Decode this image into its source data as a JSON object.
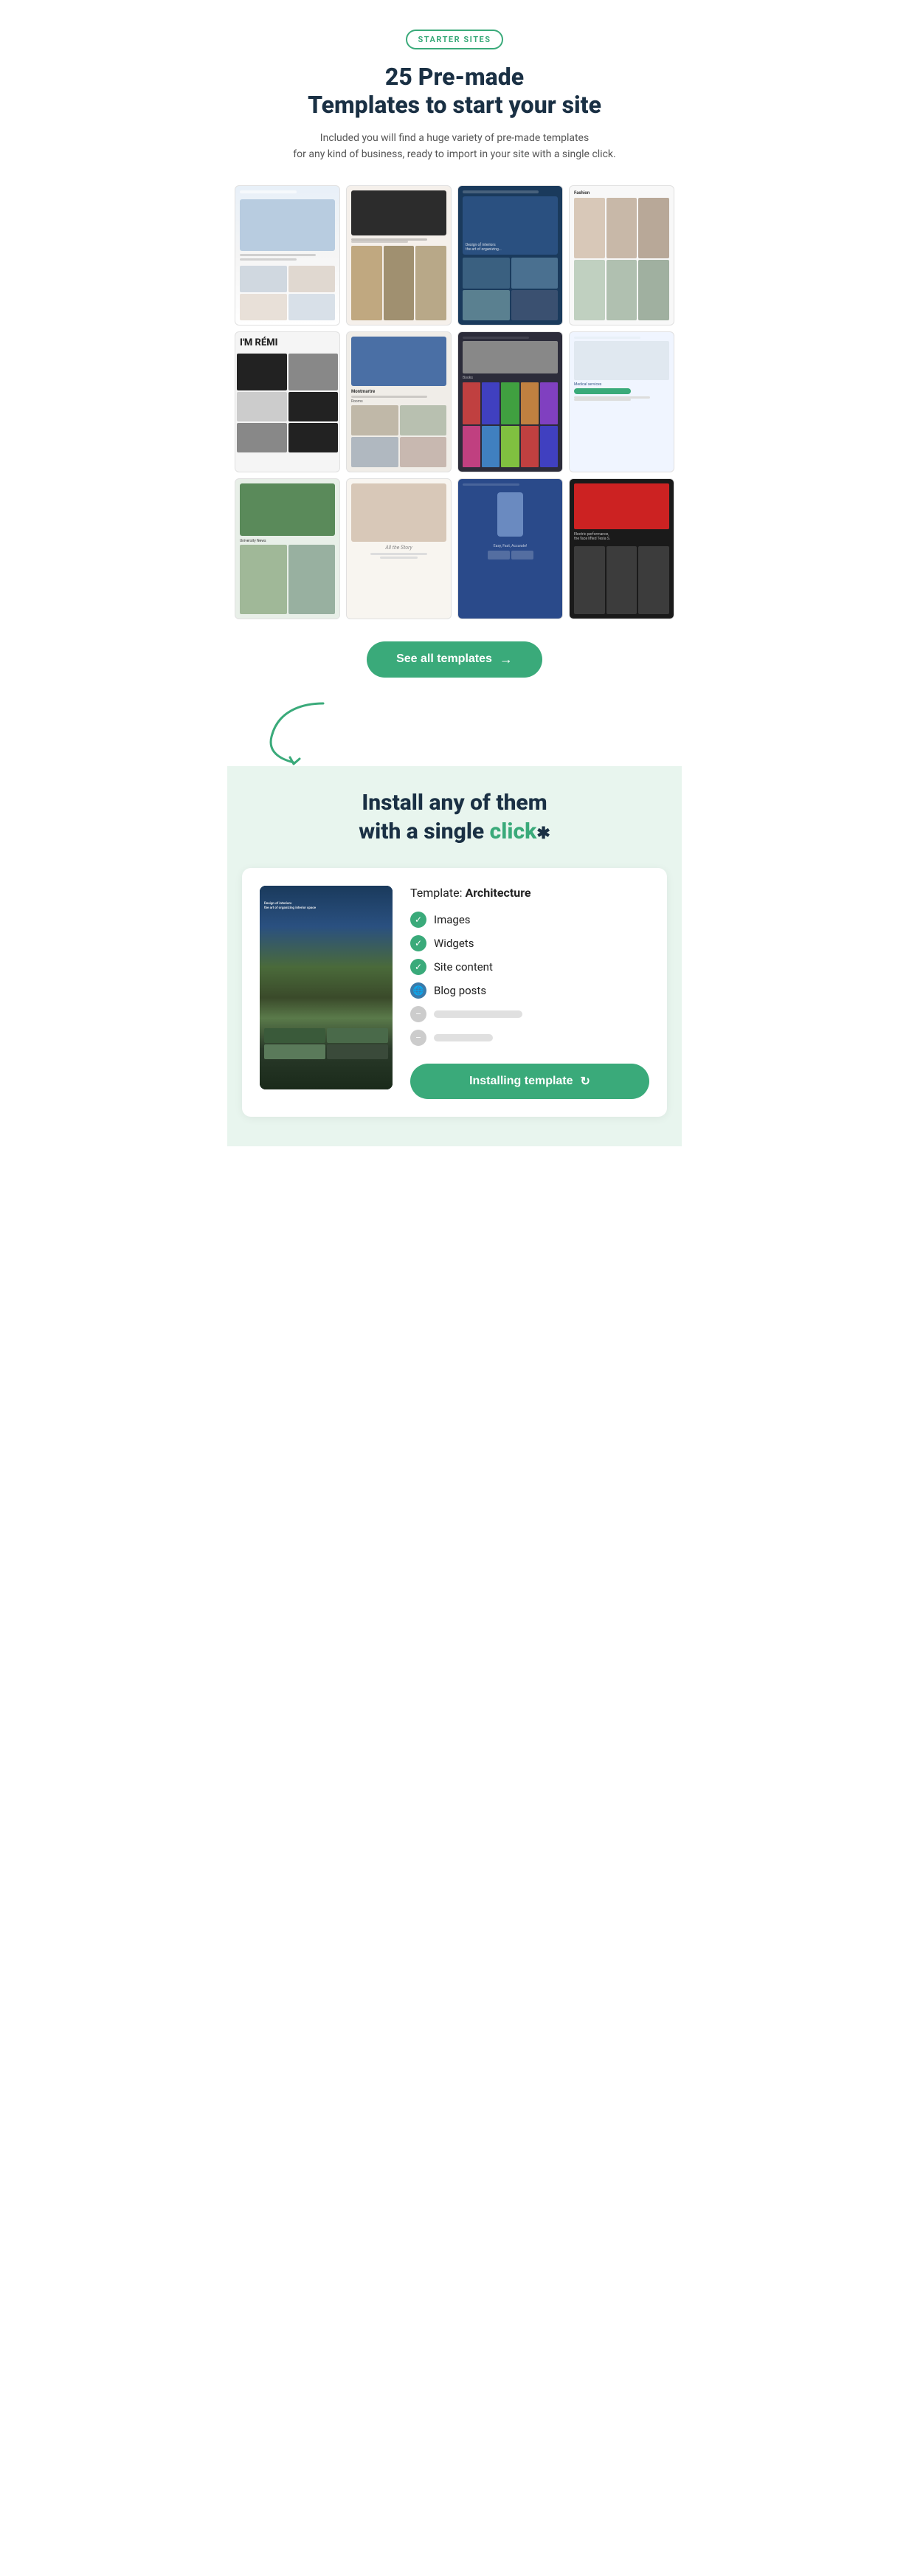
{
  "badge": {
    "label": "STARTER SITES"
  },
  "section": {
    "title_line1": "25 Pre-made",
    "title_line2": "Templates to start your site",
    "description": "Included you will find a huge variety of pre-made templates\nfor any kind of business, ready to import in your site with a single click."
  },
  "templates": [
    {
      "id": 1,
      "name": "portfolio-1",
      "style": "tmpl-1"
    },
    {
      "id": 2,
      "name": "law-firm",
      "style": "tmpl-2"
    },
    {
      "id": 3,
      "name": "architecture",
      "style": "tmpl-3"
    },
    {
      "id": 4,
      "name": "fashion-store",
      "style": "tmpl-4"
    },
    {
      "id": 5,
      "name": "remi-personal",
      "style": "card-remi"
    },
    {
      "id": 6,
      "name": "hotel",
      "style": "tmpl-6"
    },
    {
      "id": 7,
      "name": "bookstore",
      "style": "tmpl-7"
    },
    {
      "id": 8,
      "name": "medical",
      "style": "tmpl-8"
    },
    {
      "id": 9,
      "name": "university",
      "style": "tmpl-9"
    },
    {
      "id": 10,
      "name": "wedding",
      "style": "tmpl-10"
    },
    {
      "id": 11,
      "name": "weather-app",
      "style": "tmpl-12"
    },
    {
      "id": 12,
      "name": "electric-car",
      "style": "tmpl-13"
    }
  ],
  "see_all_btn": {
    "label": "See all templates",
    "arrow": "→"
  },
  "install_section": {
    "title_line1": "Install any of them",
    "title_line2_prefix": "with a single ",
    "title_line2_highlight": "click",
    "title_line2_suffix": ""
  },
  "install_card": {
    "template_label": "Template:",
    "template_name": "Architecture",
    "features": [
      {
        "label": "Images",
        "status": "checked",
        "type": "green"
      },
      {
        "label": "Widgets",
        "status": "checked",
        "type": "green"
      },
      {
        "label": "Site content",
        "status": "checked",
        "type": "green"
      },
      {
        "label": "Blog posts",
        "status": "checked",
        "type": "blue"
      },
      {
        "label": "",
        "status": "pending",
        "type": "gray"
      },
      {
        "label": "",
        "status": "pending",
        "type": "gray"
      }
    ],
    "install_btn_label": "Installing template"
  }
}
